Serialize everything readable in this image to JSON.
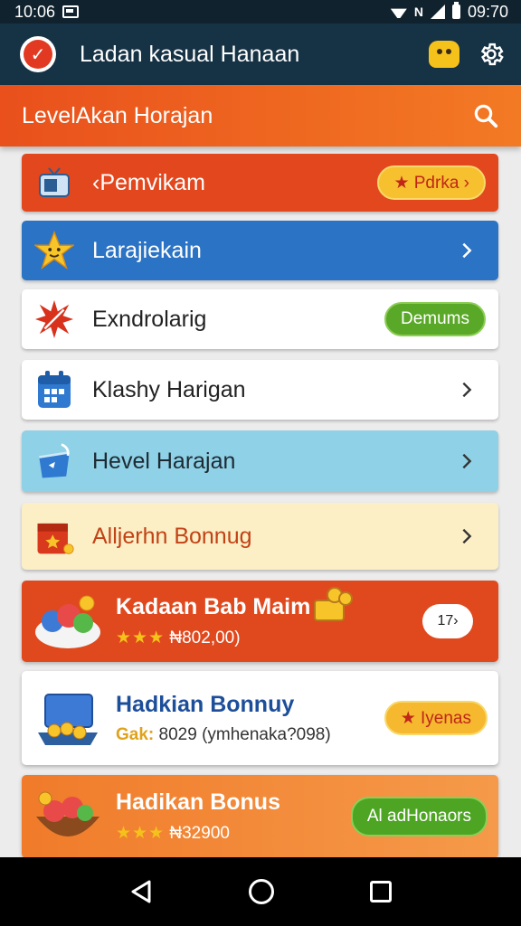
{
  "status_bar": {
    "time_left": "10:06",
    "time_right": "09:70"
  },
  "app_bar": {
    "title": "Ladan kasual Hanaan"
  },
  "header": {
    "title": "LevelAkan Horajan"
  },
  "list": [
    {
      "label": "‹Pemvikam",
      "icon": "tv-icon",
      "pill": "★ Pdrka ›"
    },
    {
      "label": "Larajiekain",
      "icon": "star-mascot-icon"
    },
    {
      "label": "Exndrolarig",
      "icon": "burst-icon",
      "pill": "Demums"
    },
    {
      "label": "Klashy Harigan",
      "icon": "calendar-icon"
    },
    {
      "label": "Hevel Harajan",
      "icon": "bucket-icon"
    },
    {
      "label": "Alljerhn Bonnug",
      "icon": "gift-box-icon"
    }
  ],
  "cards": [
    {
      "title": "Kadaan Bab Maim",
      "stars": "★★★",
      "sub": "₦802,00)",
      "bubble": "17›",
      "icon": "food-bowl-icon"
    },
    {
      "title": "Hadkian Bonnuy",
      "prefix": "Gak:",
      "sub": "8029 (ymhenaka?098)",
      "pill": "★ Iyenas",
      "icon": "laptop-coins-icon"
    },
    {
      "title": "Hadikan Bonus",
      "stars": "★★★",
      "sub": "₦32900",
      "pill": "Al adHonaors",
      "icon": "food-bowl-icon"
    }
  ],
  "colors": {
    "accent_orange": "#e9501c",
    "app_bar": "#163245",
    "blue_row": "#2b73c4",
    "green_pill": "#5aa827",
    "yellow_pill": "#f5b82e"
  }
}
